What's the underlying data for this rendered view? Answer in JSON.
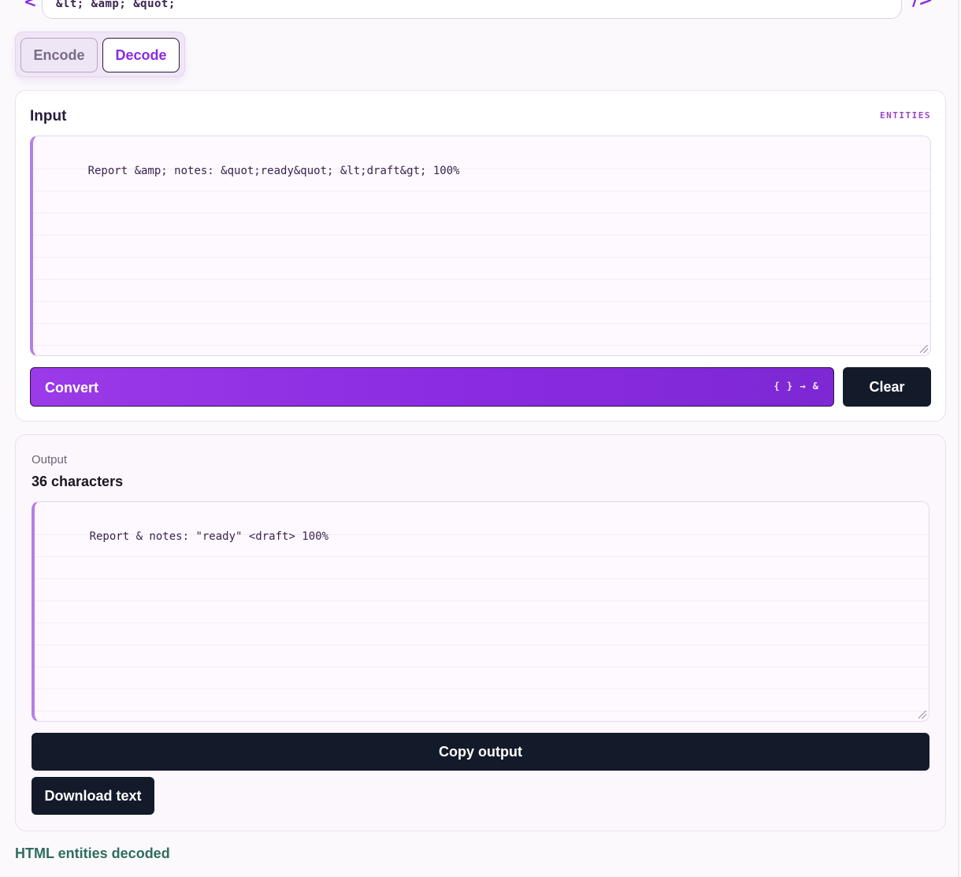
{
  "top_field": {
    "value": "&lt; &amp; &quot;",
    "left_glyph": "<",
    "right_glyph": "/>"
  },
  "mode": {
    "encode_label": "Encode",
    "decode_label": "Decode",
    "selected": "Decode"
  },
  "input_card": {
    "title": "Input",
    "tag": "ENTITIES",
    "value": "Report &amp; notes: &quot;ready&quot; &lt;draft&gt; 100%",
    "convert_label": "Convert",
    "convert_hint": "{ } → &",
    "clear_label": "Clear"
  },
  "output_card": {
    "caption": "Output",
    "count": "36 characters",
    "value": "Report & notes: \"ready\" <draft> 100%",
    "copy_label": "Copy output",
    "download_label": "Download text"
  },
  "status": {
    "text": "HTML entities decoded",
    "color": "#2e6e5e"
  },
  "colors": {
    "accent": "#8a2be2",
    "dark_button": "#131a2a",
    "textarea_border_accent": "#b77ee8"
  }
}
